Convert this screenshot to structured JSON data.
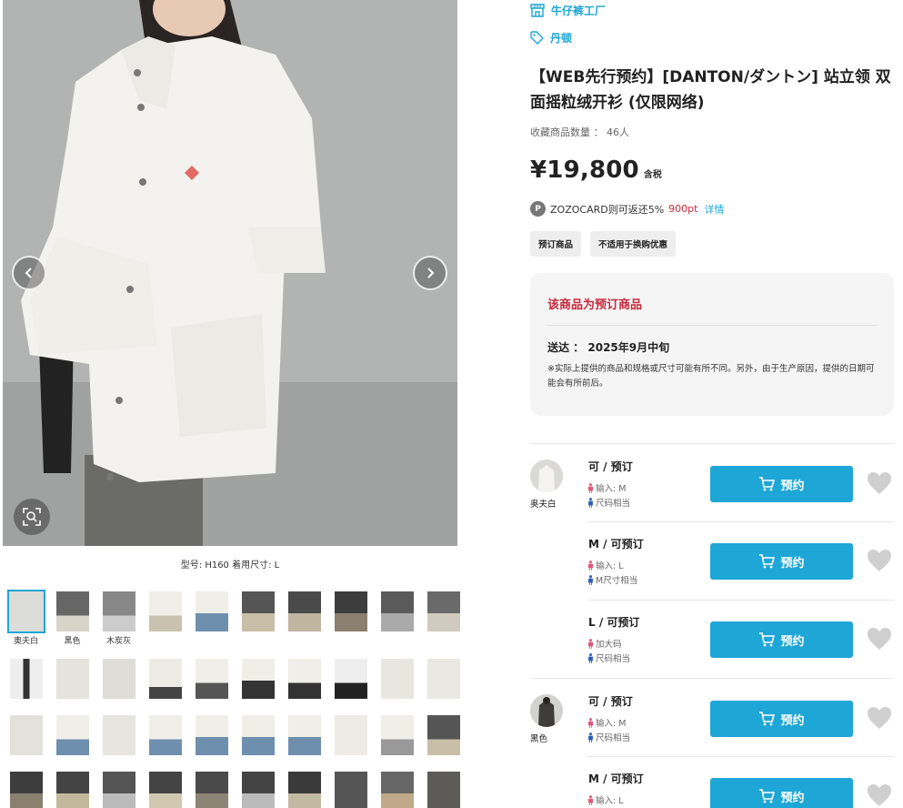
{
  "shop": {
    "name": "牛仔裤工厂",
    "icon": "shop-icon"
  },
  "brand": {
    "name": "丹顿",
    "icon": "tag-icon"
  },
  "product": {
    "title": "【WEB先行预约】[DANTON/ダントン] 站立领 双面摇粒绒开衫 (仅限网络)",
    "fav_label": "收藏商品数量 ： 46人",
    "price": "¥19,800",
    "tax_label": "含税",
    "zozocard_badge": "P",
    "zozocard_text": "ZOZOCARD则可返还5%",
    "zozocard_points": "900pt",
    "zozocard_detail": "详情",
    "tags": [
      "预订商品",
      "不适用于换购优惠"
    ]
  },
  "notice": {
    "heading": "该商品为预订商品",
    "ship_label": "送达 ：",
    "ship_date": "2025年9月中旬",
    "note": "※实际上提供的商品和规格或尺寸可能有所不同。另外，由于生产原因，提供的日期可能会有所前后。"
  },
  "gallery": {
    "model_info": "型号: H160 着用尺寸: L",
    "color_captions": [
      "奥夫白",
      "黑色",
      "木炭灰"
    ]
  },
  "variants": [
    {
      "color": "奥夫白",
      "stock": "可 / 预订",
      "line1": "输入: M",
      "line2": "尺码相当",
      "button": "预约",
      "swatch": "offwhite"
    },
    {
      "color": "",
      "stock": "M / 可预订",
      "line1": "输入: L",
      "line2": "M尺寸相当",
      "button": "预约",
      "swatch": ""
    },
    {
      "color": "",
      "stock": "L / 可预订",
      "line1": "加大码",
      "line2": "尺码相当",
      "button": "预约",
      "swatch": ""
    },
    {
      "color": "黑色",
      "stock": "可 / 预订",
      "line1": "输入: M",
      "line2": "尺码相当",
      "button": "预约",
      "swatch": "black"
    },
    {
      "color": "",
      "stock": "M / 可预订",
      "line1": "输入: L",
      "line2": "",
      "button": "预约",
      "swatch": ""
    }
  ],
  "colors": {
    "accent": "#1ea6d6",
    "sale_red": "#c62a3b",
    "notice_bg": "#f5f5f5"
  }
}
